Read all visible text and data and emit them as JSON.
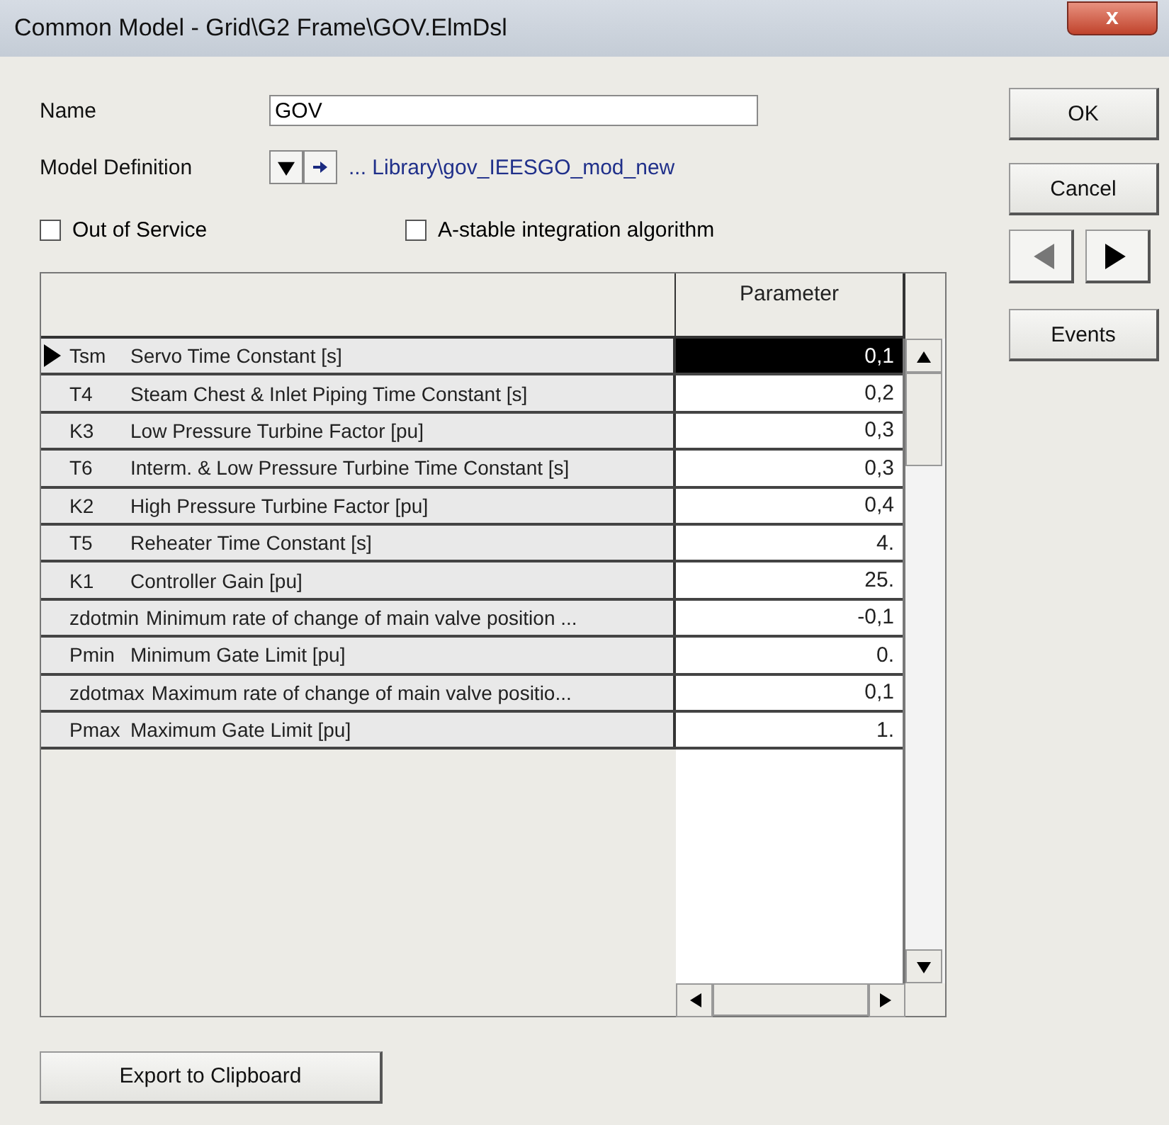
{
  "window": {
    "title": "Common Model - Grid\\G2 Frame\\GOV.ElmDsl",
    "close": "x"
  },
  "name": {
    "label": "Name",
    "value": "GOV"
  },
  "model_definition": {
    "label": "Model Definition",
    "path": "... Library\\gov_IEESGO_mod_new"
  },
  "checkboxes": [
    {
      "label": "Out of Service",
      "checked": false
    },
    {
      "label": "A-stable integration algorithm",
      "checked": false
    }
  ],
  "table": {
    "columns": [
      "Parameter"
    ],
    "rows": [
      {
        "code": "Tsm",
        "description": "Servo Time Constant [s]",
        "value": "0,1",
        "selected": true
      },
      {
        "code": "T4",
        "description": "Steam Chest & Inlet Piping Time Constant [s]",
        "value": "0,2",
        "selected": false
      },
      {
        "code": "K3",
        "description": "Low Pressure Turbine Factor [pu]",
        "value": "0,3",
        "selected": false
      },
      {
        "code": "T6",
        "description": "Interm. & Low Pressure Turbine Time Constant [s]",
        "value": "0,3",
        "selected": false
      },
      {
        "code": "K2",
        "description": "High Pressure Turbine Factor [pu]",
        "value": "0,4",
        "selected": false
      },
      {
        "code": "T5",
        "description": "Reheater Time Constant [s]",
        "value": "4.",
        "selected": false
      },
      {
        "code": "K1",
        "description": "Controller Gain [pu]",
        "value": "25.",
        "selected": false
      },
      {
        "code": "zdotmin",
        "description": "Minimum rate of change of main valve position ...",
        "value": "-0,1",
        "selected": false
      },
      {
        "code": "Pmin",
        "description": "Minimum Gate Limit [pu]",
        "value": "0.",
        "selected": false
      },
      {
        "code": "zdotmax",
        "description": "Maximum rate of change of main valve positio...",
        "value": "0,1",
        "selected": false
      },
      {
        "code": "Pmax",
        "description": "Maximum Gate Limit [pu]",
        "value": "1.",
        "selected": false
      }
    ]
  },
  "buttons": {
    "ok": "OK",
    "cancel": "Cancel",
    "events": "Events",
    "export": "Export to Clipboard"
  }
}
